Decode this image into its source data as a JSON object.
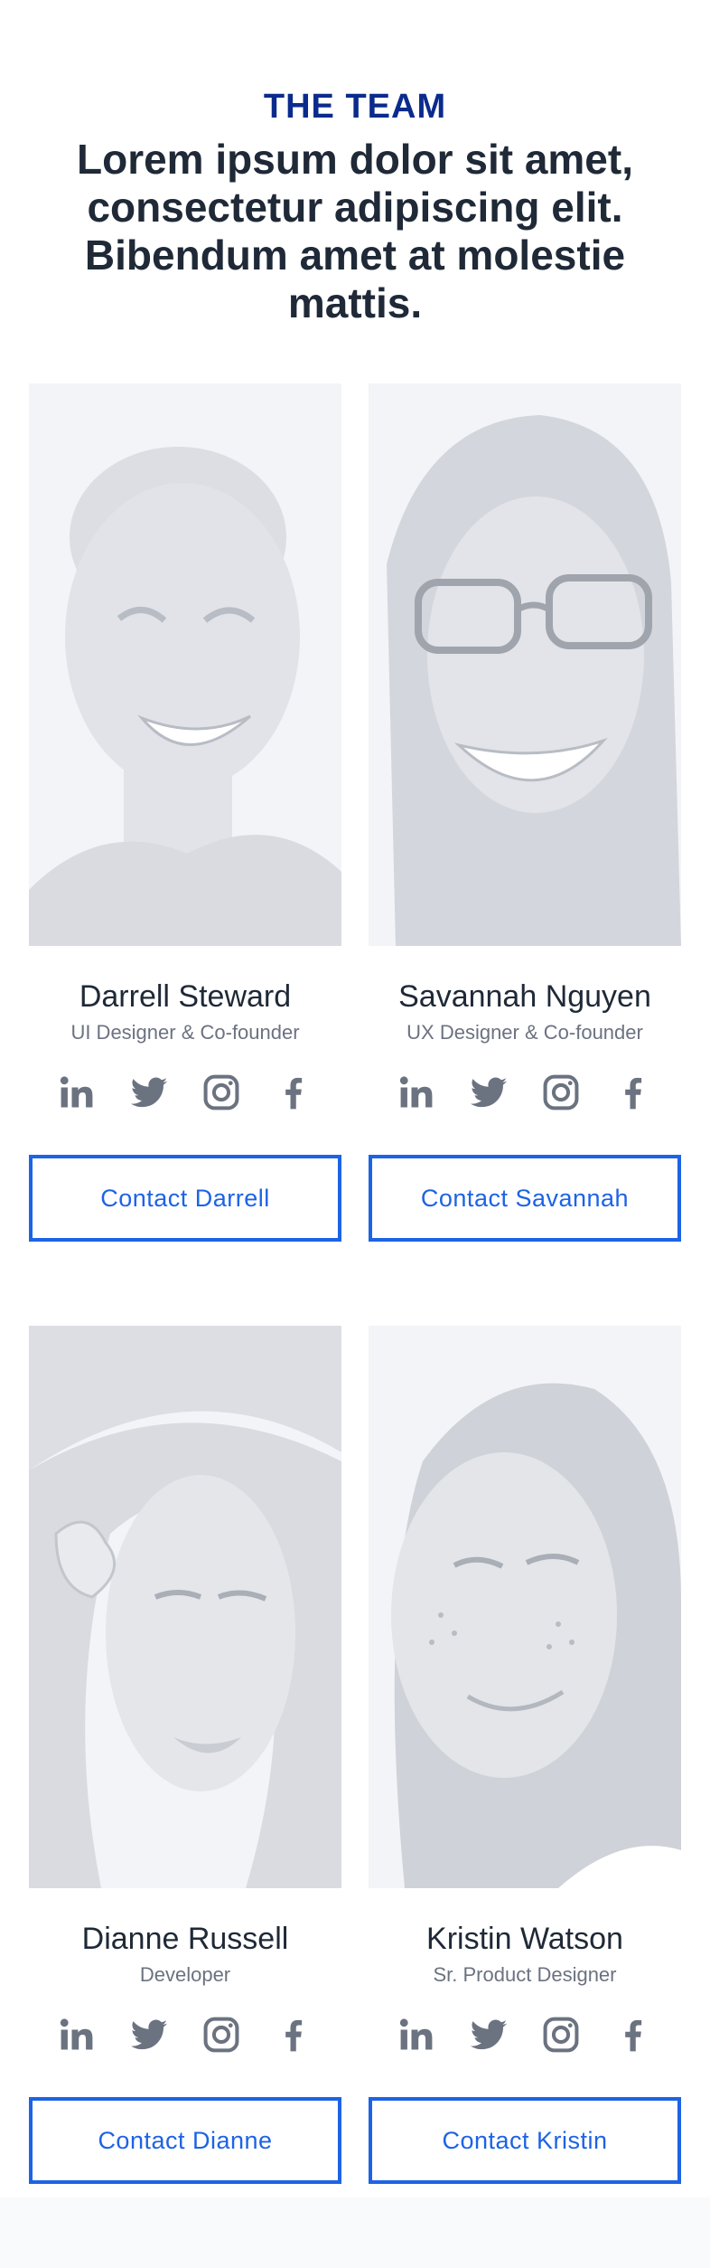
{
  "section": {
    "eyebrow": "THE TEAM",
    "headline": "Lorem ipsum dolor sit amet, consectetur adipiscing elit. Bibendum amet at molestie mattis."
  },
  "team": [
    {
      "name": "Darrell Steward",
      "role": "UI Designer & Co-founder",
      "contact_label": "Contact Darrell"
    },
    {
      "name": "Savannah Nguyen",
      "role": "UX Designer & Co-founder",
      "contact_label": "Contact Savannah"
    },
    {
      "name": "Dianne Russell",
      "role": "Developer",
      "contact_label": "Contact Dianne"
    },
    {
      "name": "Kristin Watson",
      "role": "Sr. Product Designer",
      "contact_label": "Contact Kristin"
    }
  ],
  "social_icons": [
    "linkedin-icon",
    "twitter-icon",
    "instagram-icon",
    "facebook-icon"
  ],
  "colors": {
    "eyebrow": "#0b2b8c",
    "headline": "#1f2937",
    "accent": "#1d63e5",
    "icon": "#6b7280",
    "photo_background": "#f3f4f7",
    "photo_tone": "#d7d9de"
  }
}
